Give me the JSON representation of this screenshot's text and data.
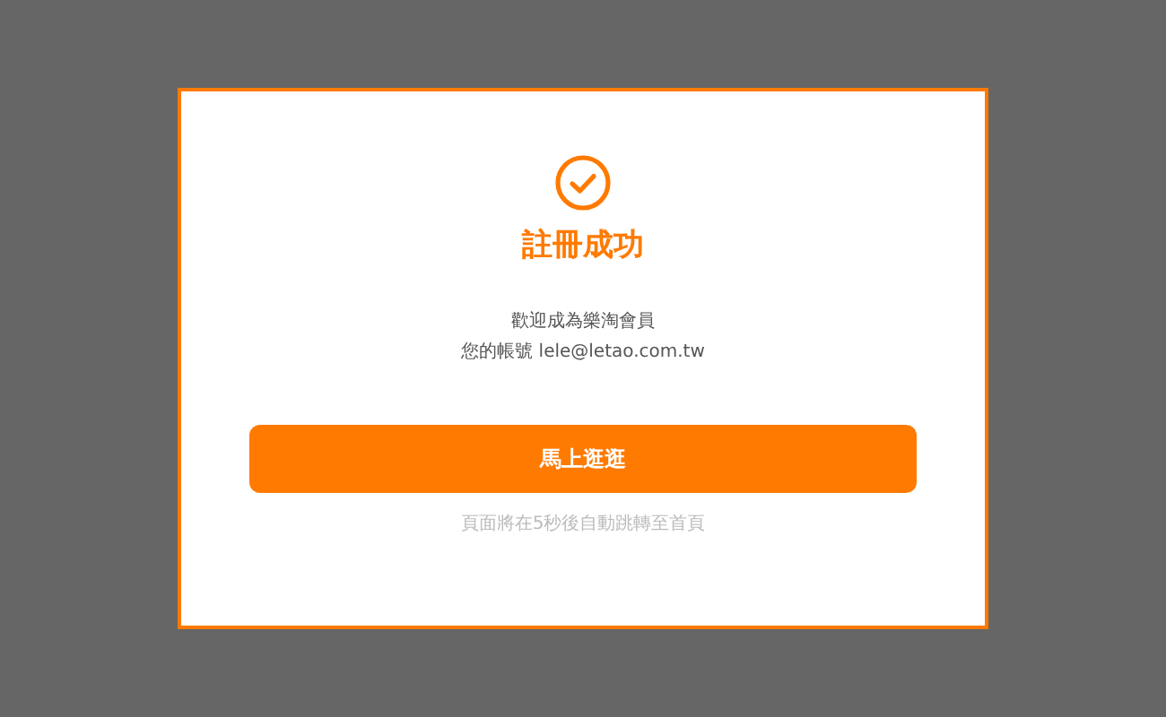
{
  "dialog": {
    "title": "註冊成功",
    "message_lines": [
      "歡迎成為樂淘會員",
      "您的帳號 lele@letao.com.tw"
    ],
    "button": "馬上逛逛",
    "note": "頁面將在5秒後自動跳轉至首頁"
  }
}
